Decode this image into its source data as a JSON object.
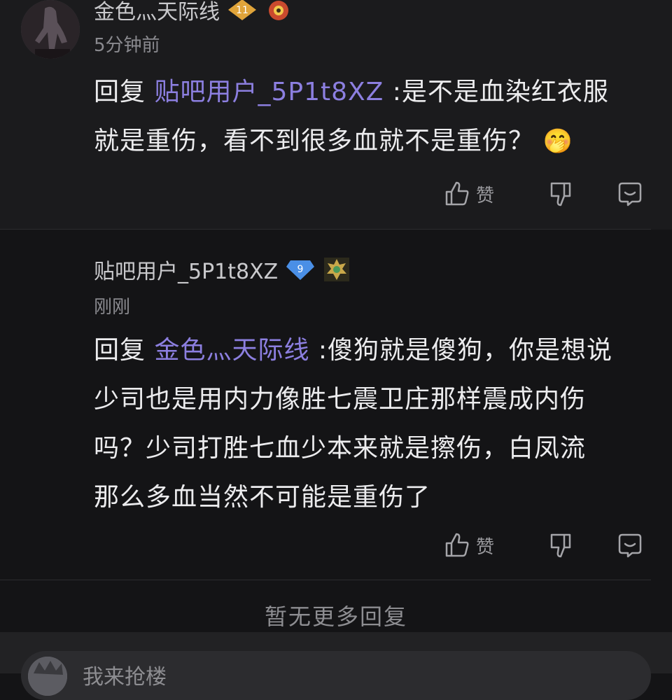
{
  "comments": [
    {
      "username": "金色灬天际线",
      "level": "11",
      "time": "5分钟前",
      "reply_prefix": "回复",
      "mention": "贴吧用户_5P1t8XZ",
      "text_line1": " :是不是血染红衣服",
      "text_line2": "就是重伤，看不到很多血就不是重伤？",
      "emoji": "🤭",
      "like_label": "赞"
    },
    {
      "username": "贴吧用户_5P1t8XZ",
      "level": "9",
      "time": "刚刚",
      "reply_prefix": "回复",
      "mention": "金色灬天际线",
      "text_line1": " :傻狗就是傻狗，你是想说",
      "text_line2": "少司也是用内力像胜七震卫庄那样震成内伤",
      "text_line3": "吗？少司打胜七血少本来就是擦伤，白凤流",
      "text_line4": "那么多血当然不可能是重伤了",
      "like_label": "赞"
    }
  ],
  "footer": {
    "no_more": "暂无更多回复",
    "input_placeholder": "我来抢楼"
  },
  "colors": {
    "background": "#141416",
    "card": "#1b1b1d",
    "mention": "#8c7fe0",
    "level_badge_gold": "#e0a43a",
    "level_badge_blue": "#4a8fe6"
  },
  "icons": [
    "thumb-up-icon",
    "thumb-down-icon",
    "reply-bubble-icon",
    "level-diamond-icon",
    "medal-icon"
  ]
}
